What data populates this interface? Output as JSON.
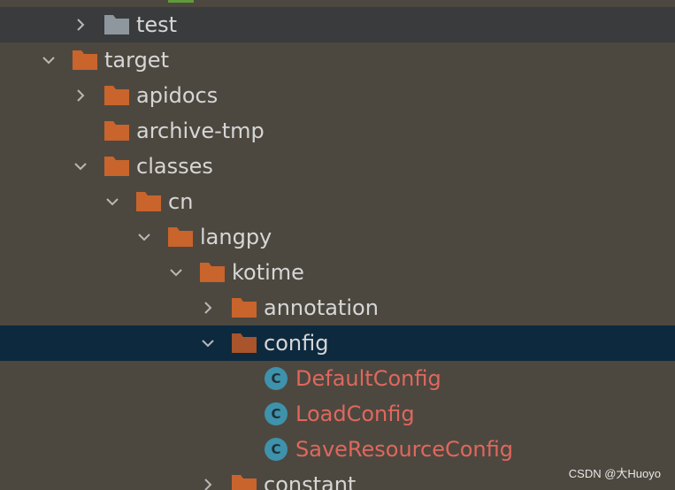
{
  "colors": {
    "panel_bg": "#4c483f",
    "header_row_bg": "#3a3b3d",
    "selected_bg": "#0d293e",
    "folder_orange": "#c9642c",
    "folder_gray": "#8e969e",
    "class_icon_bg": "#3e92ab",
    "class_text": "#e0675e",
    "text": "#d6d6d6"
  },
  "tree": {
    "items": [
      {
        "label": "test",
        "icon": "folder-gray-icon",
        "chevron": "chevron-right-icon"
      },
      {
        "label": "target",
        "icon": "folder-orange-icon",
        "chevron": "chevron-down-icon"
      },
      {
        "label": "apidocs",
        "icon": "folder-orange-icon",
        "chevron": "chevron-right-icon"
      },
      {
        "label": "archive-tmp",
        "icon": "folder-orange-icon",
        "chevron": ""
      },
      {
        "label": "classes",
        "icon": "folder-orange-icon",
        "chevron": "chevron-down-icon"
      },
      {
        "label": "cn",
        "icon": "folder-orange-icon",
        "chevron": "chevron-down-icon"
      },
      {
        "label": "langpy",
        "icon": "folder-orange-icon",
        "chevron": "chevron-down-icon"
      },
      {
        "label": "kotime",
        "icon": "folder-orange-icon",
        "chevron": "chevron-down-icon"
      },
      {
        "label": "annotation",
        "icon": "folder-orange-icon",
        "chevron": "chevron-right-icon"
      },
      {
        "label": "config",
        "icon": "folder-orange-icon",
        "chevron": "chevron-down-icon",
        "selected": true
      },
      {
        "label": "DefaultConfig",
        "icon": "class-icon",
        "icon_letter": "C"
      },
      {
        "label": "LoadConfig",
        "icon": "class-icon",
        "icon_letter": "C"
      },
      {
        "label": "SaveResourceConfig",
        "icon": "class-icon",
        "icon_letter": "C"
      },
      {
        "label": "constant",
        "icon": "folder-orange-icon",
        "chevron": "chevron-right-icon"
      }
    ]
  },
  "watermark": "CSDN @大Huoyo"
}
